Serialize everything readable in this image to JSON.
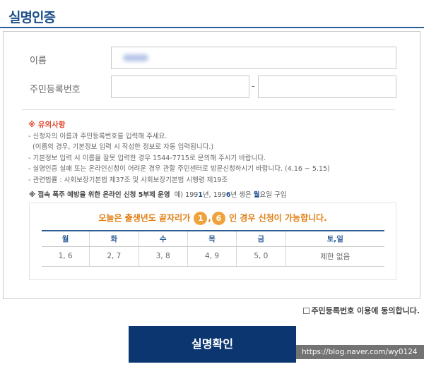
{
  "header": {
    "title": "실명인증"
  },
  "form": {
    "name_label": "이름",
    "rrn_label": "주민등록번호",
    "dash": "-"
  },
  "notes": {
    "caution": "※ 유의사항",
    "lines": [
      "- 신청자의 이름과 주민등록번호를 입력해 주세요.",
      "(이름의 경우, 기본정보 입력 시 작성한 정보로 자동 입력됩니다.)",
      "- 기본정보 입력 시 이름을 잘못 입력한 경우 1544-7715로 문의해 주시기 바랍니다.",
      "- 실명인증 실패 또는 온라인신청이 어려운 경우 관할 주민센터로 방문신청하시기 바랍니다. (4.16 ~ 5.15)",
      "- 관련법률 : 사회보장기본법 제37조 및 사회보장기본법 시행령 제19조"
    ],
    "notice_bold": "※ 접속 폭주 예방을 위한 온라인 신청 5부제 운영",
    "notice_ex_prefix": "예) 199",
    "notice_ex_d1": "1",
    "notice_ex_mid": "년, 199",
    "notice_ex_d2": "6",
    "notice_ex_mid2": "년 생은 ",
    "notice_ex_day": "월",
    "notice_ex_suffix": "요일 구입"
  },
  "rule": {
    "text_before": "오늘은 출생년도 끝자리가",
    "digit1": "1",
    "comma": ",",
    "digit2": "6",
    "text_after": "인 경우 신청이 가능합니다."
  },
  "schedule": {
    "headers": [
      "월",
      "화",
      "수",
      "목",
      "금",
      "토,일"
    ],
    "values": [
      "1, 6",
      "2, 7",
      "3, 8",
      "4, 9",
      "5, 0",
      "제한 없음"
    ]
  },
  "consent": {
    "label": "주민등록번호 이용에 동의합니다."
  },
  "confirm": {
    "label": "실명확인"
  },
  "watermark": {
    "url": "https://blog.naver.com/wy0124"
  },
  "colors": {
    "brand": "#0b3670",
    "accent": "#e07d10",
    "caution": "#e0452d"
  }
}
